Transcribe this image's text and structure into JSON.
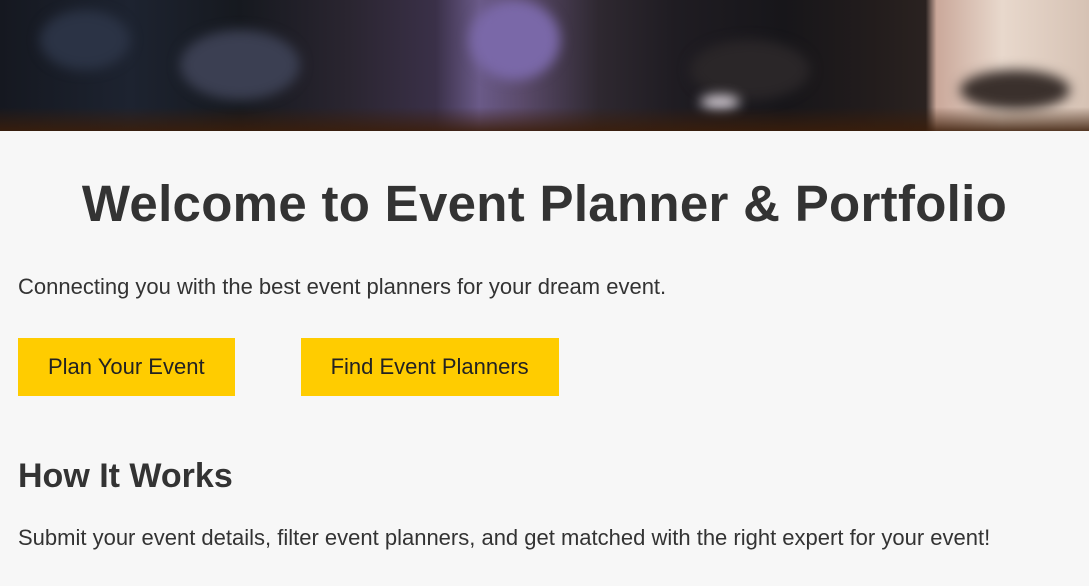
{
  "hero": {
    "image_name": "event-crowd-banner-image"
  },
  "main": {
    "title": "Welcome to Event Planner & Portfolio",
    "tagline": "Connecting you with the best event planners for your dream event.",
    "buttons": [
      {
        "label": "Plan Your Event"
      },
      {
        "label": "Find Event Planners"
      }
    ],
    "how_it_works": {
      "heading": "How It Works",
      "text": "Submit your event details, filter event planners, and get matched with the right expert for your event!"
    }
  },
  "colors": {
    "accent": "#ffcc00",
    "background": "#f7f7f7",
    "text": "#333333"
  }
}
